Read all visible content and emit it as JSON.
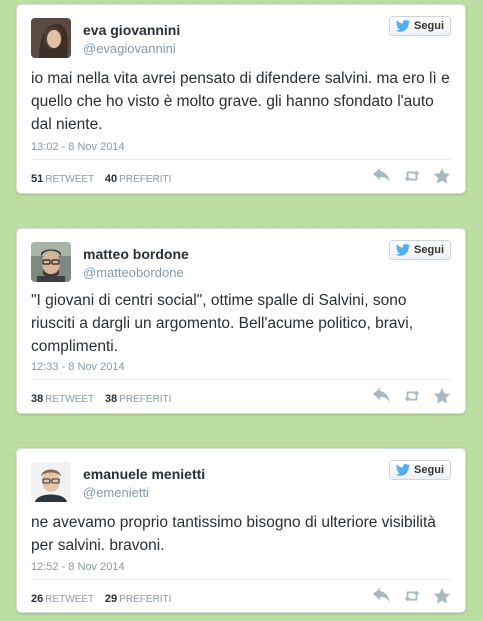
{
  "colors": {
    "background": "#b9dd9c",
    "name_text": "#292f33",
    "muted_text": "#8899a6",
    "twitter_blue": "#55acee",
    "action_icons": "#aab8c2"
  },
  "follow_label": "Segui",
  "tweets": [
    {
      "name": "eva giovannini",
      "handle": "@evagiovannini",
      "text": "io mai nella vita avrei pensato di difendere salvini. ma ero lì e quello che ho visto è molto grave. gli hanno sfondato l'auto dal niente.",
      "timestamp": "13:02 - 8 Nov 2014",
      "retweets": "51",
      "retweet_label": "RETWEET",
      "favorites": "40",
      "favorite_label": "PREFERITI"
    },
    {
      "name": "matteo bordone",
      "handle": "@matteobordone",
      "text": "\"I giovani di centri social\", ottime spalle di Salvini, sono riusciti a dargli un argomento. Bell'acume politico, bravi, complimenti.",
      "timestamp": "12:33 - 8 Nov 2014",
      "retweets": "38",
      "retweet_label": "RETWEET",
      "favorites": "38",
      "favorite_label": "PREFERITI"
    },
    {
      "name": "emanuele menietti",
      "handle": "@emenietti",
      "text": "ne avevamo proprio tantissimo bisogno di ulteriore visibilità per salvini. bravoni.",
      "timestamp": "12:52 - 8 Nov 2014",
      "retweets": "26",
      "retweet_label": "RETWEET",
      "favorites": "29",
      "favorite_label": "PREFERITI"
    }
  ]
}
